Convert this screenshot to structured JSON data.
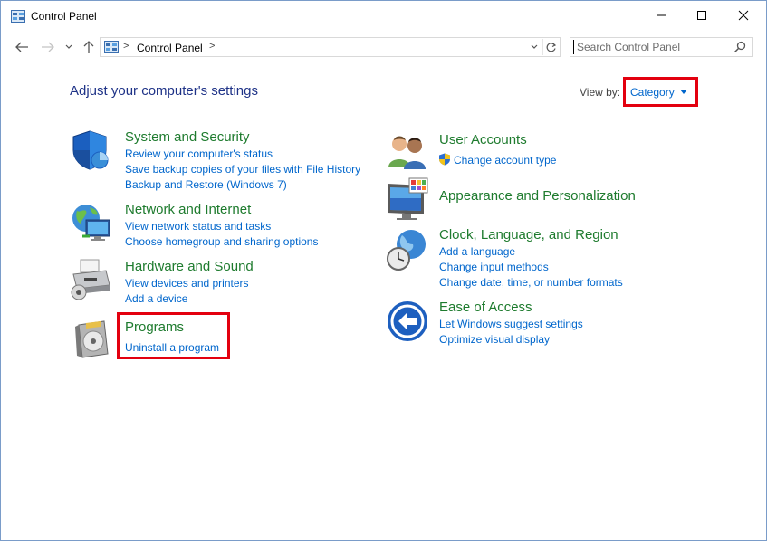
{
  "window": {
    "title": "Control Panel"
  },
  "nav": {
    "breadcrumb": "Control Panel",
    "separator": ">",
    "search_placeholder": "Search Control Panel"
  },
  "main": {
    "heading": "Adjust your computer's settings",
    "view_by_label": "View by:",
    "view_by_value": "Category"
  },
  "categories_left": [
    {
      "title": "System and Security",
      "icon": "shield-icon",
      "links": [
        "Review your computer's status",
        "Save backup copies of your files with File History",
        "Backup and Restore (Windows 7)"
      ]
    },
    {
      "title": "Network and Internet",
      "icon": "network-globe-icon",
      "links": [
        "View network status and tasks",
        "Choose homegroup and sharing options"
      ]
    },
    {
      "title": "Hardware and Sound",
      "icon": "printer-icon",
      "links": [
        "View devices and printers",
        "Add a device"
      ]
    },
    {
      "title": "Programs",
      "icon": "programs-disc-icon",
      "links": [
        "Uninstall a program"
      ]
    }
  ],
  "categories_right": [
    {
      "title": "User Accounts",
      "icon": "users-icon",
      "links": [
        "Change account type"
      ]
    },
    {
      "title": "Appearance and Personalization",
      "icon": "monitor-palette-icon",
      "links": []
    },
    {
      "title": "Clock, Language, and Region",
      "icon": "clock-globe-icon",
      "links": [
        "Add a language",
        "Change input methods",
        "Change date, time, or number formats"
      ]
    },
    {
      "title": "Ease of Access",
      "icon": "ease-of-access-icon",
      "links": [
        "Let Windows suggest settings",
        "Optimize visual display"
      ]
    }
  ],
  "colors": {
    "heading": "#1e3287",
    "category_title": "#1e7b2e",
    "link": "#0066cc",
    "highlight": "#e3000f"
  }
}
